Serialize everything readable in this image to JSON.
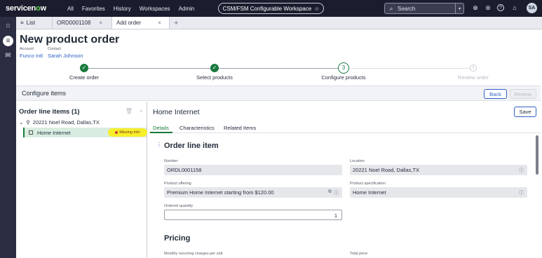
{
  "topnav": {
    "logo_pre": "servicen",
    "logo_o": "o",
    "logo_post": "w",
    "items": [
      "All",
      "Favorites",
      "History",
      "Workspaces",
      "Admin"
    ],
    "workspace": "CSM/FSM Configurable Workspace",
    "workspace_star": "☆",
    "search_placeholder": "Search",
    "search_icon": "⌕",
    "dropdown_icon": "▾",
    "icons": {
      "globe": "⊕",
      "chat": "⊚",
      "help": "?",
      "bell": "⌂"
    },
    "avatar_initials": "SA"
  },
  "rail": {
    "home": "⌂",
    "list": "≡",
    "inbox": "✉"
  },
  "tabs": [
    {
      "icon": "≡",
      "label": "List"
    },
    {
      "label": "ORD0001108",
      "close": "×"
    },
    {
      "label": "Add order",
      "close": "×"
    },
    {
      "label": "+"
    }
  ],
  "header": {
    "title": "New product order",
    "tag_icon": "⬡",
    "account_label": "Account",
    "account_value": "Funco Intl",
    "contact_label": "Contact",
    "contact_value": "Sarah Johnson"
  },
  "stepper": {
    "steps": [
      {
        "label": "Create order",
        "state": "done",
        "mark": "✓"
      },
      {
        "label": "Select products",
        "state": "done",
        "mark": "✓"
      },
      {
        "label": "Configure products",
        "state": "current",
        "mark": "3"
      },
      {
        "label": "Review order",
        "state": "pending",
        "mark": "4"
      }
    ],
    "colors": {
      "done": "#1a7a3e",
      "pending": "#c9ccd5"
    }
  },
  "config": {
    "title": "Configure items",
    "back": "Back",
    "review": "Review"
  },
  "order_lines": {
    "title": "Order line items (1)",
    "delete_icon": "🗑",
    "add_icon": "+",
    "address": "20221 Noel Road, Dallas,TX",
    "caret": "⌄",
    "pin": "⚲",
    "item": "Home Internet",
    "missing": "Missing Info"
  },
  "detail": {
    "title": "Home Internet",
    "save": "Save",
    "tabs": [
      "Details",
      "Characteristics",
      "Related Items"
    ],
    "drag_icon": "⋮",
    "section_title": "Order line item",
    "number_label": "Number",
    "number_value": "ORDL0001158",
    "location_label": "Location",
    "location_value": "20221 Noel Road, Dallas,TX",
    "offering_label": "Product offering",
    "offering_value": "Premium Home Internet starting from $120.00",
    "spec_label": "Product specification",
    "spec_value": "Home Internet",
    "qty_label": "Ordered quantity",
    "qty_value": "1",
    "info_icon": "ⓘ",
    "copy_icon": "⧉",
    "pricing_title": "Pricing",
    "monthly_label": "Monthly recurring charges per unit",
    "total_label": "Total price"
  }
}
